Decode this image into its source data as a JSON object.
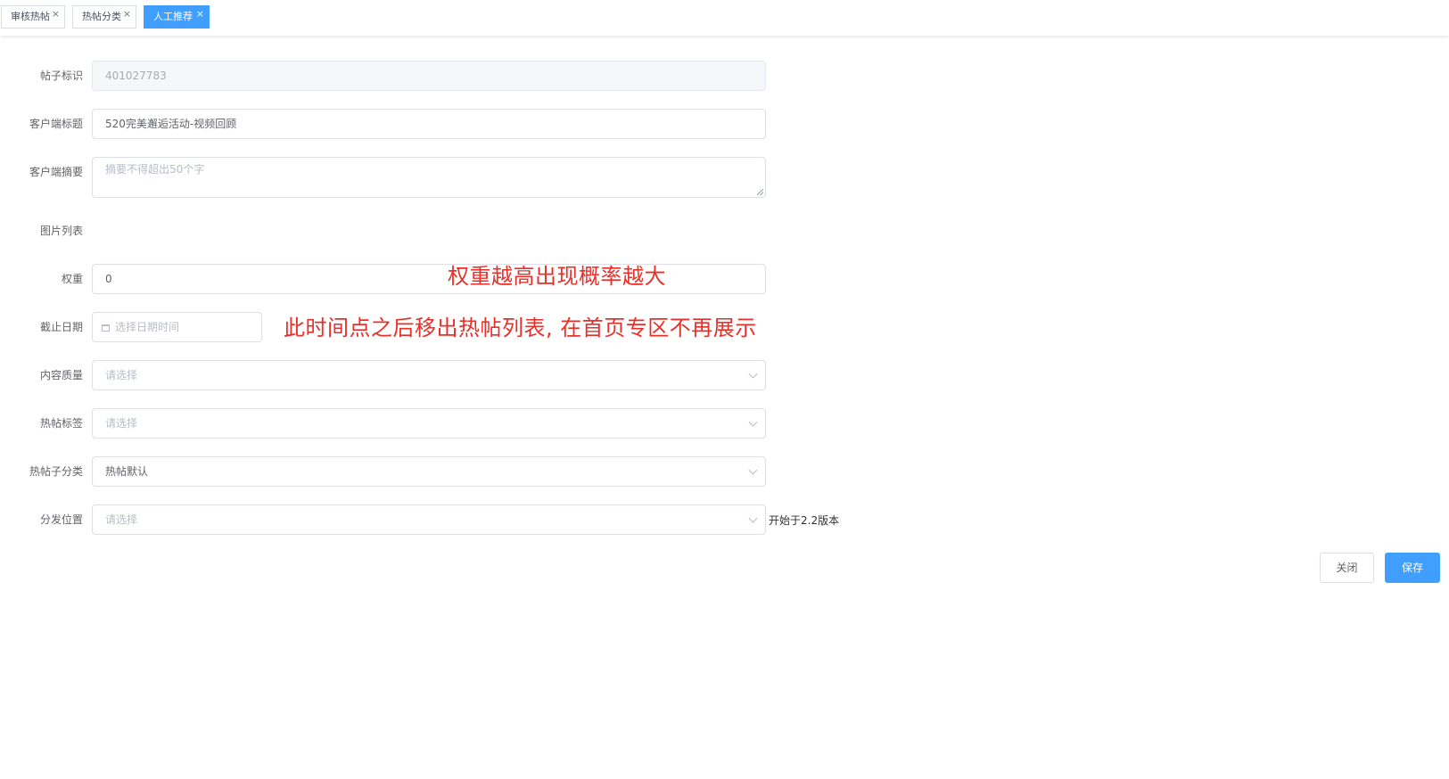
{
  "tabs": [
    {
      "label": "审核热帖",
      "close": "×"
    },
    {
      "label": "热帖分类",
      "close": "×"
    },
    {
      "label": "人工推荐",
      "close": "×"
    }
  ],
  "form": {
    "post_id": {
      "label": "帖子标识",
      "value": "401027783"
    },
    "client_title": {
      "label": "客户端标题",
      "value": "520完美邂逅活动-视频回顾"
    },
    "client_summary": {
      "label": "客户端摘要",
      "placeholder": "摘要不得超出50个字"
    },
    "image_list": {
      "label": "图片列表"
    },
    "weight": {
      "label": "权重",
      "value": "0"
    },
    "deadline": {
      "label": "截止日期",
      "placeholder": "选择日期时间"
    },
    "content_quality": {
      "label": "内容质量",
      "placeholder": "请选择"
    },
    "hot_tags": {
      "label": "热帖标签",
      "placeholder": "请选择"
    },
    "sub_category": {
      "label": "热帖子分类",
      "value": "热帖默认"
    },
    "distribution": {
      "label": "分发位置",
      "placeholder": "请选择",
      "note": "开始于2.2版本"
    }
  },
  "annotations": {
    "weight_hint": "权重越高出现概率越大",
    "deadline_hint": "此时间点之后移出热帖列表, 在首页专区不再展示"
  },
  "buttons": {
    "close": "关闭",
    "save": "保存"
  },
  "colors": {
    "primary": "#409eff",
    "annotation": "#e8302a"
  }
}
